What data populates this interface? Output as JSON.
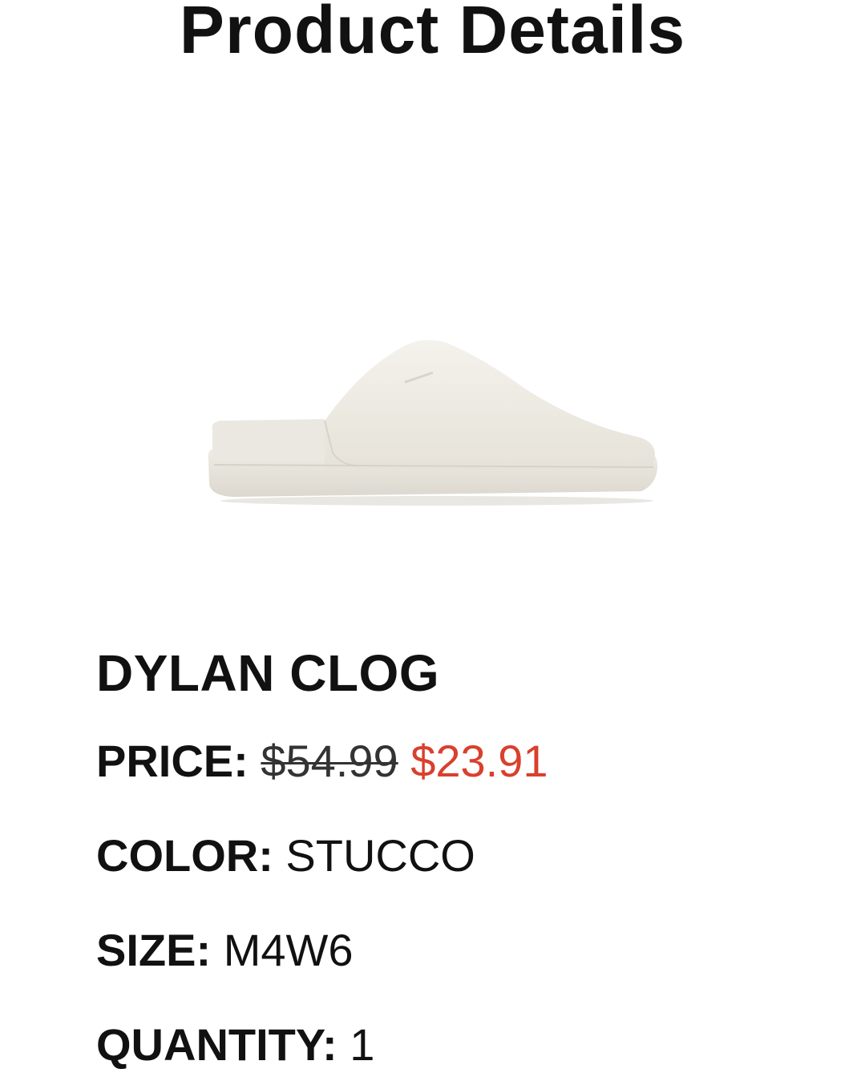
{
  "header": {
    "title": "Product Details"
  },
  "product": {
    "image": {
      "icon": "clog-shoe-image",
      "color": "#ece9e2"
    },
    "name": "DYLAN CLOG",
    "price": {
      "label": "PRICE:",
      "original": "$54.99",
      "sale": "$23.91",
      "sale_color": "#d9402d"
    },
    "color": {
      "label": "COLOR:",
      "value": "STUCCO"
    },
    "size": {
      "label": "SIZE:",
      "value": "M4W6"
    },
    "quantity": {
      "label": "QUANTITY:",
      "value": "1"
    }
  }
}
